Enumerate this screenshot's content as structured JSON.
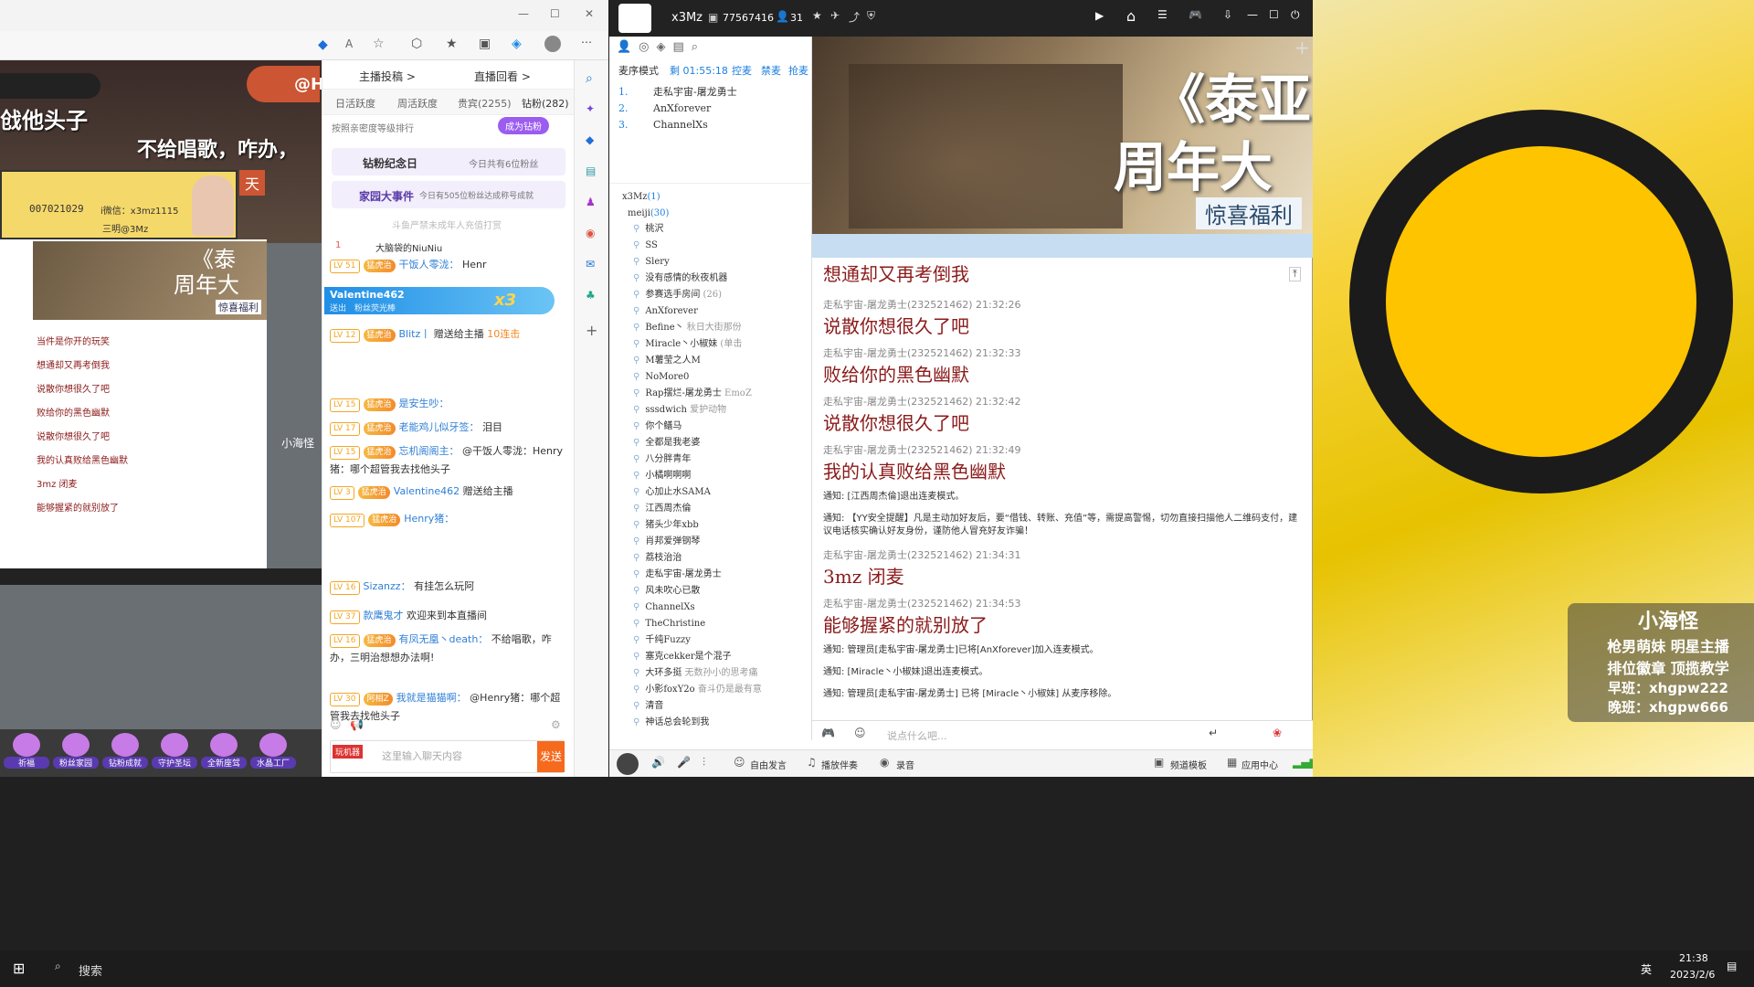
{
  "browser": {
    "win_min": "—",
    "win_max": "☐",
    "win_close": "✕"
  },
  "stream_overlay": {
    "line1": "戗他头子",
    "line2": "不给唱歌，咋办，",
    "uid": "007021029",
    "info": "i微信：x3mz1115",
    "sub": "三明@3Mz",
    "yy_label": "@H",
    "tian": "天",
    "promo1": "《泰",
    "promo2": "周年大",
    "promo3": "惊喜福利",
    "mini_chat": [
      "当件是你开的玩笑",
      "想通却又再考倒我",
      "说散你想很久了吧",
      "败给你的黑色幽默",
      "说散你想很久了吧",
      "我的认真败给黑色幽默",
      "3mz 闭麦",
      "能够握紧的就别放了"
    ],
    "watermark": "小海怪"
  },
  "douyu": {
    "tabs_top": [
      "主播投稿 >",
      "直播回看 >"
    ],
    "tabs": [
      "日活跃度",
      "周活跃度",
      "贵宾(2255)",
      "钻粉(282)"
    ],
    "sort_label": "按照亲密度等级排行",
    "become_fan": "成为钻粉",
    "fan_day": "钻粉纪念日",
    "fan_day_note": "今日共有6位粉丝",
    "family": "家园大事件",
    "family_note": "今日有505位粉丝达成称号成就",
    "minor_notice": "斗鱼严禁未成年人充值打赏",
    "rank1": "1",
    "rank1_name": "大脑袋的NiuNiu",
    "gift_banner_user": "Valentine462",
    "gift_banner_desc": "送出　粉丝荧光棒",
    "gift_banner_count": "x3",
    "chat": [
      {
        "lv": "LV 51",
        "badge": "猛虎治",
        "name": "干饭人零泷：",
        "text": "Henr"
      },
      {
        "lv": "LV 12",
        "badge": "猛虎治",
        "name": "Blitz丨",
        "text": "赠送给主播",
        "gift": "10连击"
      },
      {
        "lv": "LV 15",
        "badge": "猛虎治",
        "name": "是安生吵：",
        "text": ""
      },
      {
        "lv": "LV 17",
        "badge": "猛虎治",
        "name": "老能鸡儿似牙签：",
        "text": "泪目"
      },
      {
        "lv": "LV 15",
        "badge": "猛虎治",
        "name": "忘机阁阁主：",
        "text": "@干饭人零泷：Henry猪：哪个超管我去找他头子"
      },
      {
        "lv": "LV 3",
        "badge": "猛虎治",
        "name": "Valentine462",
        "text": "赠送给主播"
      },
      {
        "lv": "LV 107",
        "badge": "猛虎治",
        "name": "Henry猪：",
        "text": ""
      },
      {
        "lv": "LV 16",
        "badge": "",
        "name": "Sizanzz：",
        "text": "有挂怎么玩阿"
      },
      {
        "lv": "LV 37",
        "badge": "",
        "name": "款鹰鬼才",
        "text": "欢迎来到本直播间"
      },
      {
        "lv": "LV 16",
        "badge": "猛虎治",
        "name": "有凤无凰丶death：",
        "text": "不给唱歌，咋办，三明治想想办法啊!"
      },
      {
        "lv": "LV 30",
        "badge": "阿相Z",
        "name": "我就是猫猫啊：",
        "text": "@Henry猪：哪个超管我去找他头子"
      }
    ],
    "input_placeholder": "这里输入聊天内容",
    "send": "发送",
    "chest_label": "玩机器",
    "bottom_icons": [
      "祈福",
      "粉丝家园",
      "钻粉成就",
      "守护圣坛",
      "全新座驾",
      "水晶工厂"
    ]
  },
  "yy": {
    "title": "x3Mz",
    "room_id": "77567416",
    "online": "31",
    "mic_mode": "麦序模式",
    "timer": "剩 01:55:18",
    "actions": [
      "控麦",
      "禁麦",
      "抢麦"
    ],
    "mic_queue": [
      {
        "n": "1.",
        "name": "走私宇宙-屠龙勇士"
      },
      {
        "n": "2.",
        "name": "AnXforever"
      },
      {
        "n": "3.",
        "name": "ChannelXs"
      }
    ],
    "tree_root": "x3Mz",
    "tree_root_count": "(1)",
    "sub_channel": "meiji",
    "sub_channel_count": "(30)",
    "members": [
      "桃沢",
      "SS",
      "Slery",
      "没有感情的秋夜机器",
      "参赛选手房间",
      "AnXforever",
      "Befine丶",
      "Miracle丶小椒妹",
      "M薯莹之人M",
      "NoMore0",
      "Rap摆烂-屠龙勇士",
      "sssdwich",
      "你个鳝马",
      "全都是我老婆",
      "八分胖青年",
      "小橘啊啊啊",
      "心加止水SAMA",
      "江西周杰倫",
      "猪头少年xbb",
      "肖邦爱弹钢琴",
      "荔枝治治",
      "走私宇宙-屠龙勇士",
      "风未吹心已散",
      "ChannelXs",
      "TheChristine",
      "千纯Fuzzy",
      "塞克cekker是个混子",
      "大环多挺",
      "小影foxY2o",
      "清音",
      "神话总会轮到我"
    ],
    "member_notes": [
      "",
      "",
      "",
      "",
      "(26)",
      "",
      "秋日大街那份",
      "(单击",
      "",
      "",
      "EmoZ",
      "爱护动物",
      "",
      "",
      "",
      "",
      "",
      "",
      "",
      "",
      "",
      "",
      "",
      "",
      "",
      "",
      "",
      "无数孙小的思考痛",
      "奋斗仍是最有意",
      "",
      ""
    ],
    "banner_title1": "《泰亚",
    "banner_title2": "周年大",
    "banner_sub": "惊喜福利",
    "messages": [
      {
        "type": "lyric",
        "text": "想通却又再考倒我"
      },
      {
        "type": "chat",
        "user": "走私宇宙-屠龙勇士(232521462)",
        "time": "21:32:26",
        "text": "说散你想很久了吧"
      },
      {
        "type": "chat",
        "user": "走私宇宙-屠龙勇士(232521462)",
        "time": "21:32:33",
        "text": "败给你的黑色幽默"
      },
      {
        "type": "chat",
        "user": "走私宇宙-屠龙勇士(232521462)",
        "time": "21:32:42",
        "text": "说散你想很久了吧"
      },
      {
        "type": "chat",
        "user": "走私宇宙-屠龙勇士(232521462)",
        "time": "21:32:49",
        "text": "我的认真败给黑色幽默"
      },
      {
        "type": "notice",
        "text": "通知: [江西周杰倫]退出连麦模式。"
      },
      {
        "type": "notice",
        "text": "通知: 【YY安全提醒】凡是主动加好友后，要“借钱、转账、充值”等，需提高警惕，切勿直接扫描他人二维码支付，建议电话核实确认好友身份，谨防他人冒充好友诈骗！"
      },
      {
        "type": "chat",
        "user": "走私宇宙-屠龙勇士(232521462)",
        "time": "21:34:31",
        "text": "3mz 闭麦"
      },
      {
        "type": "chat",
        "user": "走私宇宙-屠龙勇士(232521462)",
        "time": "21:34:53",
        "text": "能够握紧的就别放了"
      },
      {
        "type": "notice",
        "text": "通知: 管理员[走私宇宙-屠龙勇士]已将[AnXforever]加入连麦模式。"
      },
      {
        "type": "notice",
        "text": "通知: [Miracle丶小椒妹]退出连麦模式。"
      },
      {
        "type": "notice",
        "text": "通知: 管理员[走私宇宙-屠龙勇士] 已将 [Miracle丶小椒妹] 从麦序移除。"
      }
    ],
    "input_placeholder": "说点什么吧...",
    "bottom": {
      "free_speak": "自由发言",
      "play_accomp": "播放伴奏",
      "record": "录音",
      "channel_template": "频道模板",
      "app_center": "应用中心"
    }
  },
  "right_overlay": {
    "title": "小海怪",
    "l1": "枪男萌妹 明星主播",
    "l2": "排位徽章 顶揽教学",
    "l3": "早班：xhgpw222",
    "l4": "晚班：xhgpw666"
  },
  "taskbar": {
    "search": "搜索",
    "time": "21:38",
    "date": "2023/2/6",
    "lang": "英"
  }
}
